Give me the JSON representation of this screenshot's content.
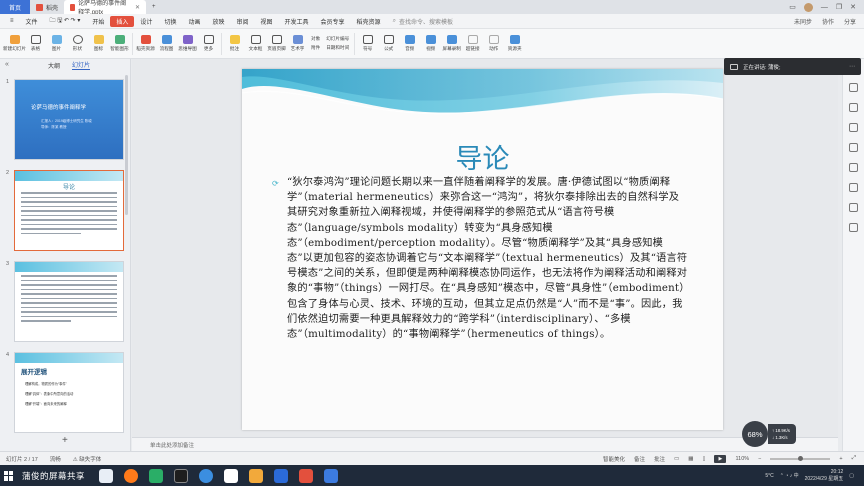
{
  "tabs": {
    "home": "首页",
    "tab2": "稻壳",
    "active": "论萨马德的事件阐释学.pptx"
  },
  "menubar": {
    "file": "文件",
    "items": [
      "开始",
      "插入",
      "设计",
      "切换",
      "动画",
      "放映",
      "审阅",
      "视图",
      "开发工具",
      "会员专享",
      "稻壳资源"
    ],
    "active_index": 1,
    "search_placeholder": "查找命令、搜索模板",
    "right": [
      "未同步",
      "协作",
      "分享"
    ]
  },
  "ribbon": {
    "buttons": [
      "新建幻灯片",
      "表格",
      "图片",
      "形状",
      "图标",
      "智能图形",
      "稻壳资源",
      "流程图",
      "思维导图",
      "更多",
      "批注",
      "文本框",
      "页眉页脚",
      "艺术字"
    ],
    "mini": [
      "对象",
      "附件",
      "幻灯片编号",
      "日期和时间"
    ],
    "buttons2": [
      "符号",
      "公式",
      "音频",
      "视频",
      "屏幕录制",
      "超链接",
      "动作",
      "资源夹"
    ]
  },
  "leftpanel": {
    "tab_outline": "大纲",
    "tab_slides": "幻灯片",
    "slide1_title": "论萨马德的事件阐释学",
    "slide1_line1": "汇报人：2019级博士研究生 陈峻",
    "slide1_line2": "导师：陈某 教授",
    "slide2_title": "导论",
    "slide4_title": "展开逻辑",
    "slide4_lines": [
      "理解构成，物质的作为“事件”",
      "理解“具体”：表象中所意向的活动",
      "理解“开端”：面向未来的阐释"
    ]
  },
  "slide": {
    "title": "导论",
    "body": "“狄尔泰鸿沟”理论问题长期以来一直伴随着阐释学的发展。唐·伊德试图以“物质阐释学”（material hermeneutics）来弥合这一“鸿沟”，将狄尔泰排除出去的自然科学及其研究对象重新拉入阐释视域，并使得阐释学的参照范式从“语言符号模态”（language/symbols modality）转变为“具身感知模态”（embodiment/perception modality）。尽管“物质阐释学”及其“具身感知模态”以更加包容的姿态协调着它与“文本阐释学”（textual hermeneutics）及其“语言符号模态”之间的关系，但即便是两种阐释模态协同运作，也无法将作为阐释活动和阐释对象的“事物”（things）一网打尽。在“具身感知”模态中，尽管“具身性”（embodiment）包含了身体与心灵、技术、环境的互动，但其立足点仍然是“人”而不是“事”。因此，我们依然迫切需要一种更具解释效力的“跨学科”（interdisciplinary）、“多模态”（multimodality）的“事物阐释学”（hermeneutics of things）。"
  },
  "notes_placeholder": "单击此处添加备注",
  "share": {
    "label": "正在讲话: 蒲俊;"
  },
  "zoom_badge": "68%",
  "speed": {
    "up": "18.9K/s",
    "down": "1.3K/s"
  },
  "statusbar": {
    "slide_count": "幻灯片 2 / 17",
    "theme": "流畅",
    "missing_font": "缺失字体",
    "beautify": "智能美化",
    "notes": "备注",
    "comments": "批注",
    "zoom": "110%"
  },
  "taskbar": {
    "label": "蒲俊的屏幕共享",
    "time": "20:12",
    "date": "2022/4/29 星期五",
    "temp": "5°C"
  },
  "colors": {
    "accent": "#e3503d",
    "title": "#2a8ab8",
    "taskbar": "#1f2a3a"
  }
}
